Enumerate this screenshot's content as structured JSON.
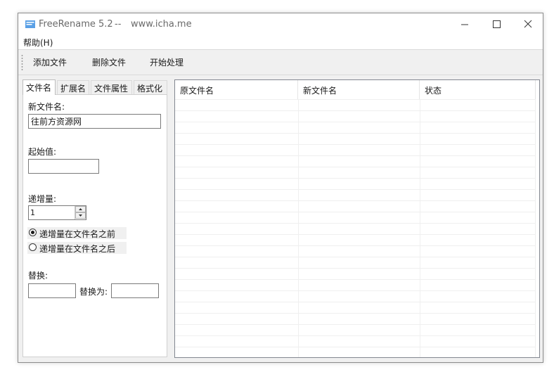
{
  "window": {
    "title": "FreeRename 5.2",
    "title_sep": "--",
    "title_url": "www.icha.me"
  },
  "menu": {
    "help": "帮助(H)"
  },
  "toolbar": {
    "add_files": "添加文件",
    "delete_files": "删除文件",
    "start_processing": "开始处理"
  },
  "tabs": [
    {
      "label": "文件名",
      "active": true
    },
    {
      "label": "扩展名",
      "active": false
    },
    {
      "label": "文件属性",
      "active": false
    },
    {
      "label": "格式化",
      "active": false
    }
  ],
  "panel": {
    "new_name_label": "新文件名:",
    "new_name_value": "往前方资源网",
    "start_label": "起始值:",
    "start_value": "",
    "increment_label": "递增量:",
    "increment_value": "1",
    "radio_before": "递增量在文件名之前",
    "radio_after": "递增量在文件名之后",
    "radio_selected": "before",
    "replace_label": "替换:",
    "replace_value": "",
    "replace_with_label": "替换为:",
    "replace_with_value": ""
  },
  "list": {
    "columns": [
      "原文件名",
      "新文件名",
      "状态"
    ],
    "rows": []
  },
  "colors": {
    "window_bg": "#f0f0f0",
    "border": "#828790",
    "icon_blue": "#5aa0e6"
  },
  "icons": [
    "app-icon",
    "minimize-icon",
    "maximize-icon",
    "close-icon",
    "spin-up-icon",
    "spin-down-icon"
  ]
}
